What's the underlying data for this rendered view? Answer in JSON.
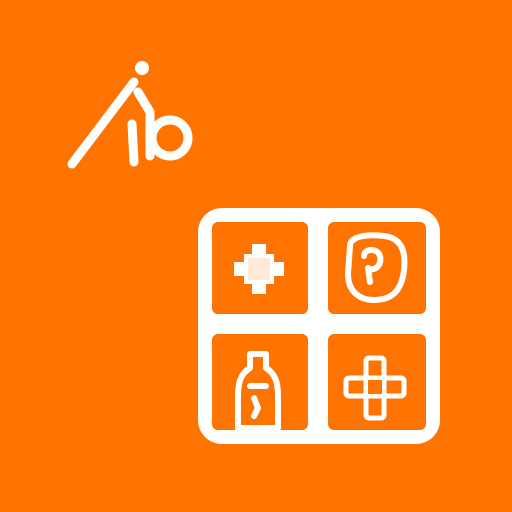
{
  "colors": {
    "background": "#FF7300",
    "foreground": "#FFFFFF"
  },
  "logo": {
    "icon": "wheelchair-stick-figure-icon"
  },
  "tile": {
    "icon": "four-quadrant-grid-icon",
    "quadrants": [
      {
        "position": "top-left",
        "icon": "plus-icon"
      },
      {
        "position": "top-right",
        "icon": "badge-icon"
      },
      {
        "position": "bottom-left",
        "icon": "bottle-icon"
      },
      {
        "position": "bottom-right",
        "icon": "sparkle-plus-icon"
      }
    ]
  }
}
